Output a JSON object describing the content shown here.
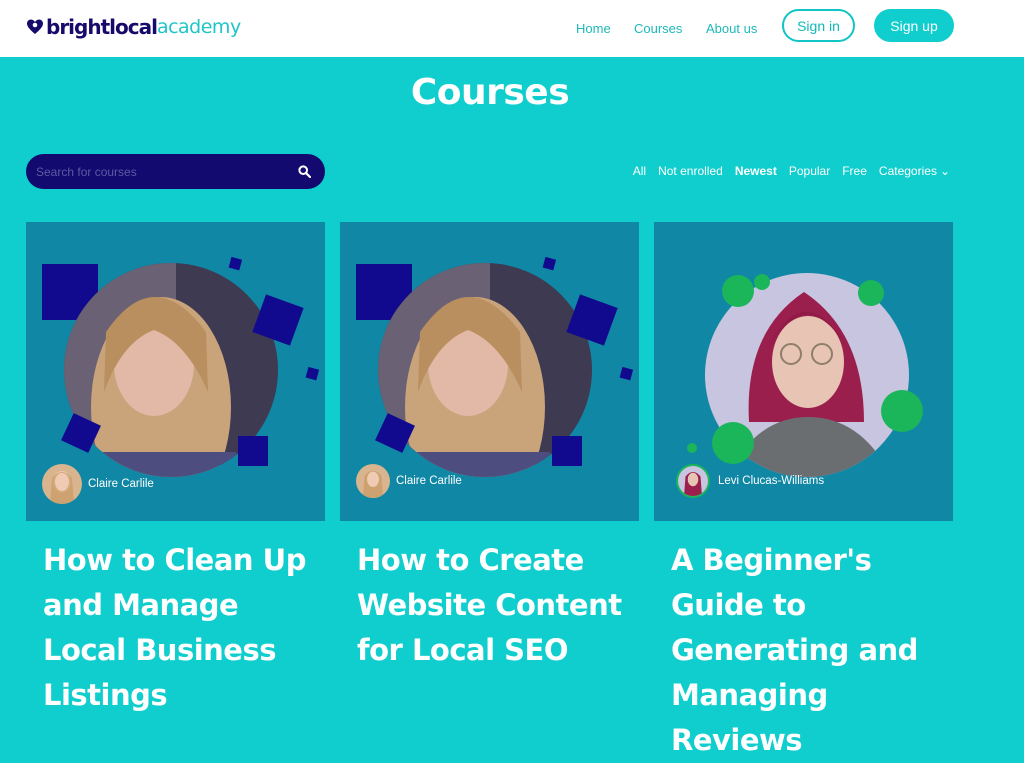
{
  "header": {
    "logo_bright": "brightlocal",
    "logo_academy": "academy",
    "nav": [
      "Home",
      "Courses",
      "About us"
    ],
    "sign_in": "Sign in",
    "sign_up": "Sign up"
  },
  "page": {
    "title": "Courses"
  },
  "search": {
    "placeholder": "Search for courses"
  },
  "filters": {
    "items": [
      "All",
      "Not enrolled",
      "Newest",
      "Popular",
      "Free",
      "Categories"
    ],
    "active": "Newest"
  },
  "courses": [
    {
      "title": "How to Clean Up and Manage Local Business Listings",
      "author": "Claire Carlile"
    },
    {
      "title": "How to Create Website Content for Local SEO",
      "author": "Claire Carlile"
    },
    {
      "title": "A Beginner's Guide to Generating and Managing Reviews",
      "author": "Levi Clucas-Williams"
    }
  ],
  "colors": {
    "background": "#10cecd",
    "navy": "#120a6e",
    "card_image_bg": "#0f87a5",
    "green_accent": "#1bb55a"
  }
}
